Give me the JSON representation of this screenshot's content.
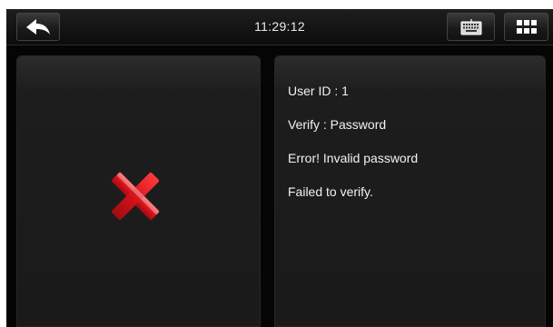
{
  "header": {
    "time": "11:29:12",
    "back_icon": "back-arrow-icon",
    "keyboard_icon": "keyboard-icon",
    "menu_icon": "grid-menu-icon"
  },
  "result": {
    "icon": "red-x-failure-icon",
    "icon_color": "#d4121a"
  },
  "info": {
    "lines": [
      "User ID : 1",
      "Verify : Password",
      "Error! Invalid password",
      "Failed to verify."
    ]
  }
}
